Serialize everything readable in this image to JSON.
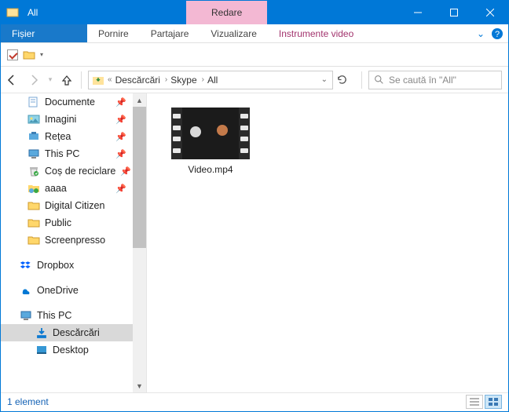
{
  "window": {
    "title": "All",
    "context_tab": "Redare"
  },
  "ribbon": {
    "file": "Fișier",
    "tabs": [
      "Pornire",
      "Partajare",
      "Vizualizare"
    ],
    "context": "Instrumente video"
  },
  "breadcrumb": {
    "segments": [
      "Descărcări",
      "Skype",
      "All"
    ]
  },
  "search": {
    "placeholder": "Se caută în \"All\""
  },
  "sidebar": {
    "pinned": [
      {
        "label": "Documente",
        "icon": "doc"
      },
      {
        "label": "Imagini",
        "icon": "pic"
      },
      {
        "label": "Rețea",
        "icon": "net"
      },
      {
        "label": "This PC",
        "icon": "pc"
      },
      {
        "label": "Coș de reciclare",
        "icon": "bin"
      },
      {
        "label": "aaaa",
        "icon": "folder-share"
      },
      {
        "label": "Digital Citizen",
        "icon": "folder"
      },
      {
        "label": "Public",
        "icon": "folder"
      },
      {
        "label": "Screenpresso",
        "icon": "folder"
      }
    ],
    "top": [
      {
        "label": "Dropbox",
        "icon": "dropbox"
      },
      {
        "label": "OneDrive",
        "icon": "onedrive"
      },
      {
        "label": "This PC",
        "icon": "pc"
      }
    ],
    "selected": {
      "label": "Descărcări",
      "icon": "down"
    },
    "cut": {
      "label": "Desktop",
      "icon": "desktop"
    }
  },
  "files": [
    {
      "name": "Video.mp4"
    }
  ],
  "status": {
    "count_text": "1 element"
  }
}
